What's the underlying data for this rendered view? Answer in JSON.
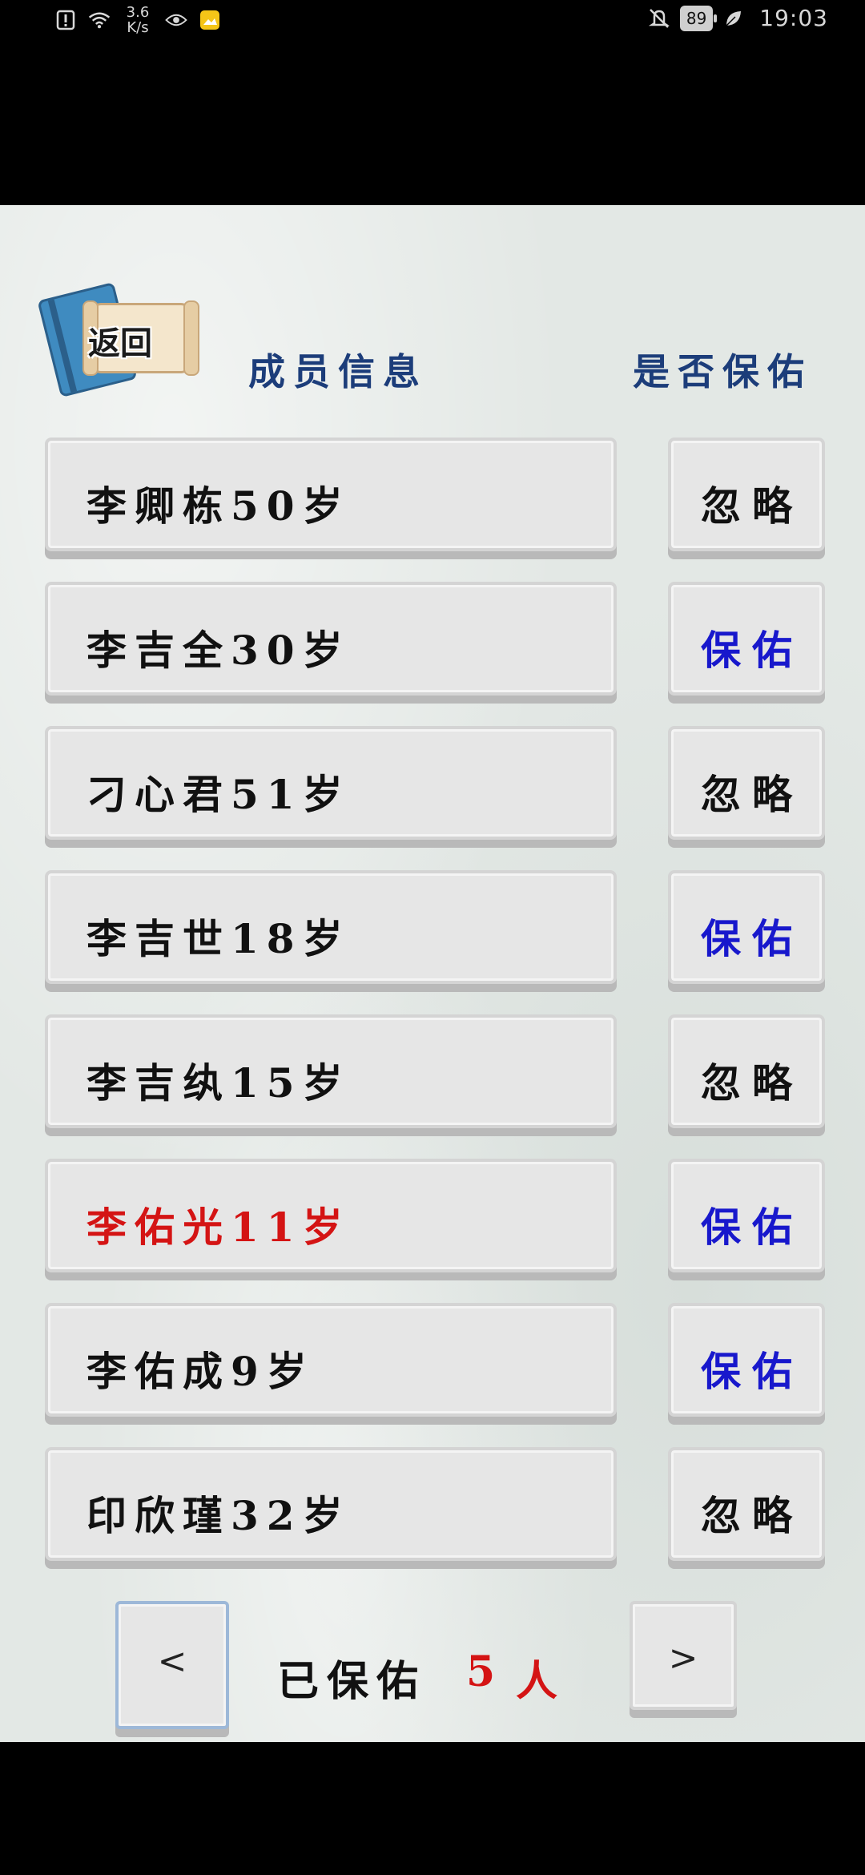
{
  "status_bar": {
    "net_speed_value": "3.6",
    "net_speed_unit": "K/s",
    "battery": "89",
    "time": "19:03",
    "icons": [
      "alert-icon",
      "wifi-icon",
      "eye-icon",
      "gallery-icon",
      "mute-icon",
      "leaf-icon"
    ]
  },
  "header": {
    "back_label": "返回",
    "col_info": "成员信息",
    "col_bless": "是否保佑"
  },
  "members": [
    {
      "name": "李卿栋50岁",
      "status": "忽略",
      "status_type": "ignore",
      "highlight": false
    },
    {
      "name": "李吉全30岁",
      "status": "保佑",
      "status_type": "bless",
      "highlight": false
    },
    {
      "name": "刁心君51岁",
      "status": "忽略",
      "status_type": "ignore",
      "highlight": false
    },
    {
      "name": "李吉世18岁",
      "status": "保佑",
      "status_type": "bless",
      "highlight": false
    },
    {
      "name": "李吉纨15岁",
      "status": "忽略",
      "status_type": "ignore",
      "highlight": false
    },
    {
      "name": "李佑光11岁",
      "status": "保佑",
      "status_type": "bless",
      "highlight": true
    },
    {
      "name": "李佑成9岁",
      "status": "保佑",
      "status_type": "bless",
      "highlight": false
    },
    {
      "name": "印欣瑾32岁",
      "status": "忽略",
      "status_type": "ignore",
      "highlight": false
    }
  ],
  "footer": {
    "prev_label": "<",
    "next_label": ">",
    "count_label": "已保佑",
    "count_value": "5",
    "count_unit": "人"
  },
  "colors": {
    "bless": "#1818cc",
    "highlight": "#d41414",
    "header": "#1c3d7a"
  }
}
